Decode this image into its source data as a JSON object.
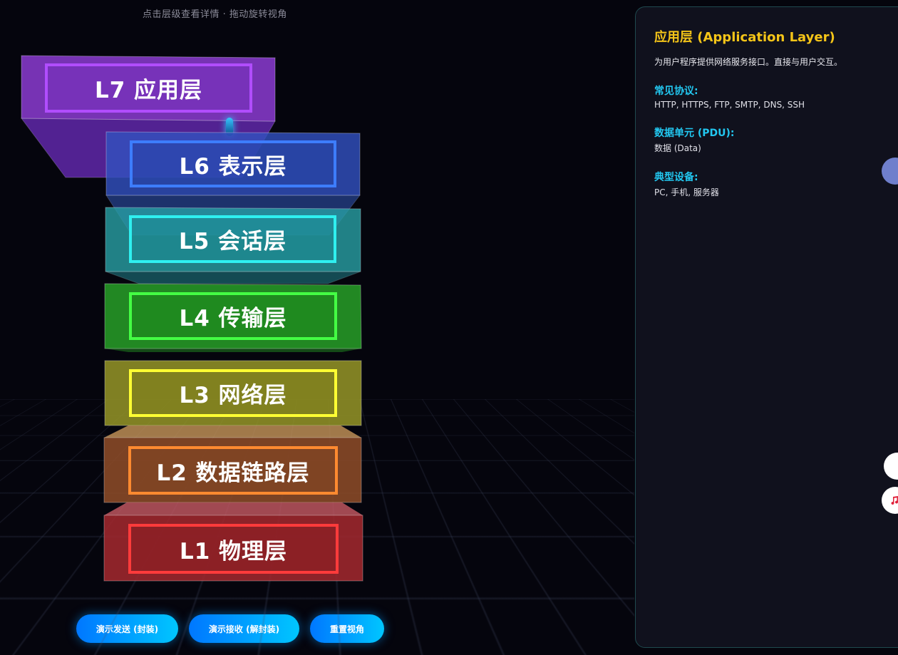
{
  "hint": "点击层级查看详情 · 拖动旋转视角",
  "layers": [
    {
      "label": "L7 应用层",
      "color": "#a640ff"
    },
    {
      "label": "L6 表示层",
      "color": "#3d7dff"
    },
    {
      "label": "L5 会话层",
      "color": "#29e0e6"
    },
    {
      "label": "L4 传输层",
      "color": "#3ee63e"
    },
    {
      "label": "L3 网络层",
      "color": "#ffff33"
    },
    {
      "label": "L2 数据链路层",
      "color": "#ff8a30"
    },
    {
      "label": "L1 物理层",
      "color": "#ff3b3b"
    }
  ],
  "buttons": {
    "send": "演示发送 (封装)",
    "receive": "演示接收 (解封装)",
    "reset": "重置视角"
  },
  "panel": {
    "title": "应用层 (Application Layer)",
    "description": "为用户程序提供网络服务接口。直接与用户交互。",
    "protocols_heading": "常见协议:",
    "protocols_value": "HTTP, HTTPS, FTP, SMTP, DNS, SSH",
    "pdu_heading": "数据单元 (PDU):",
    "pdu_value": "数据 (Data)",
    "devices_heading": "典型设备:",
    "devices_value": "PC, 手机, 服务器"
  },
  "colors": {
    "accent_title": "#f5c518",
    "accent_heading": "#22c7f0",
    "button_gradient_start": "#0077ff",
    "button_gradient_end": "#00c6ff"
  }
}
